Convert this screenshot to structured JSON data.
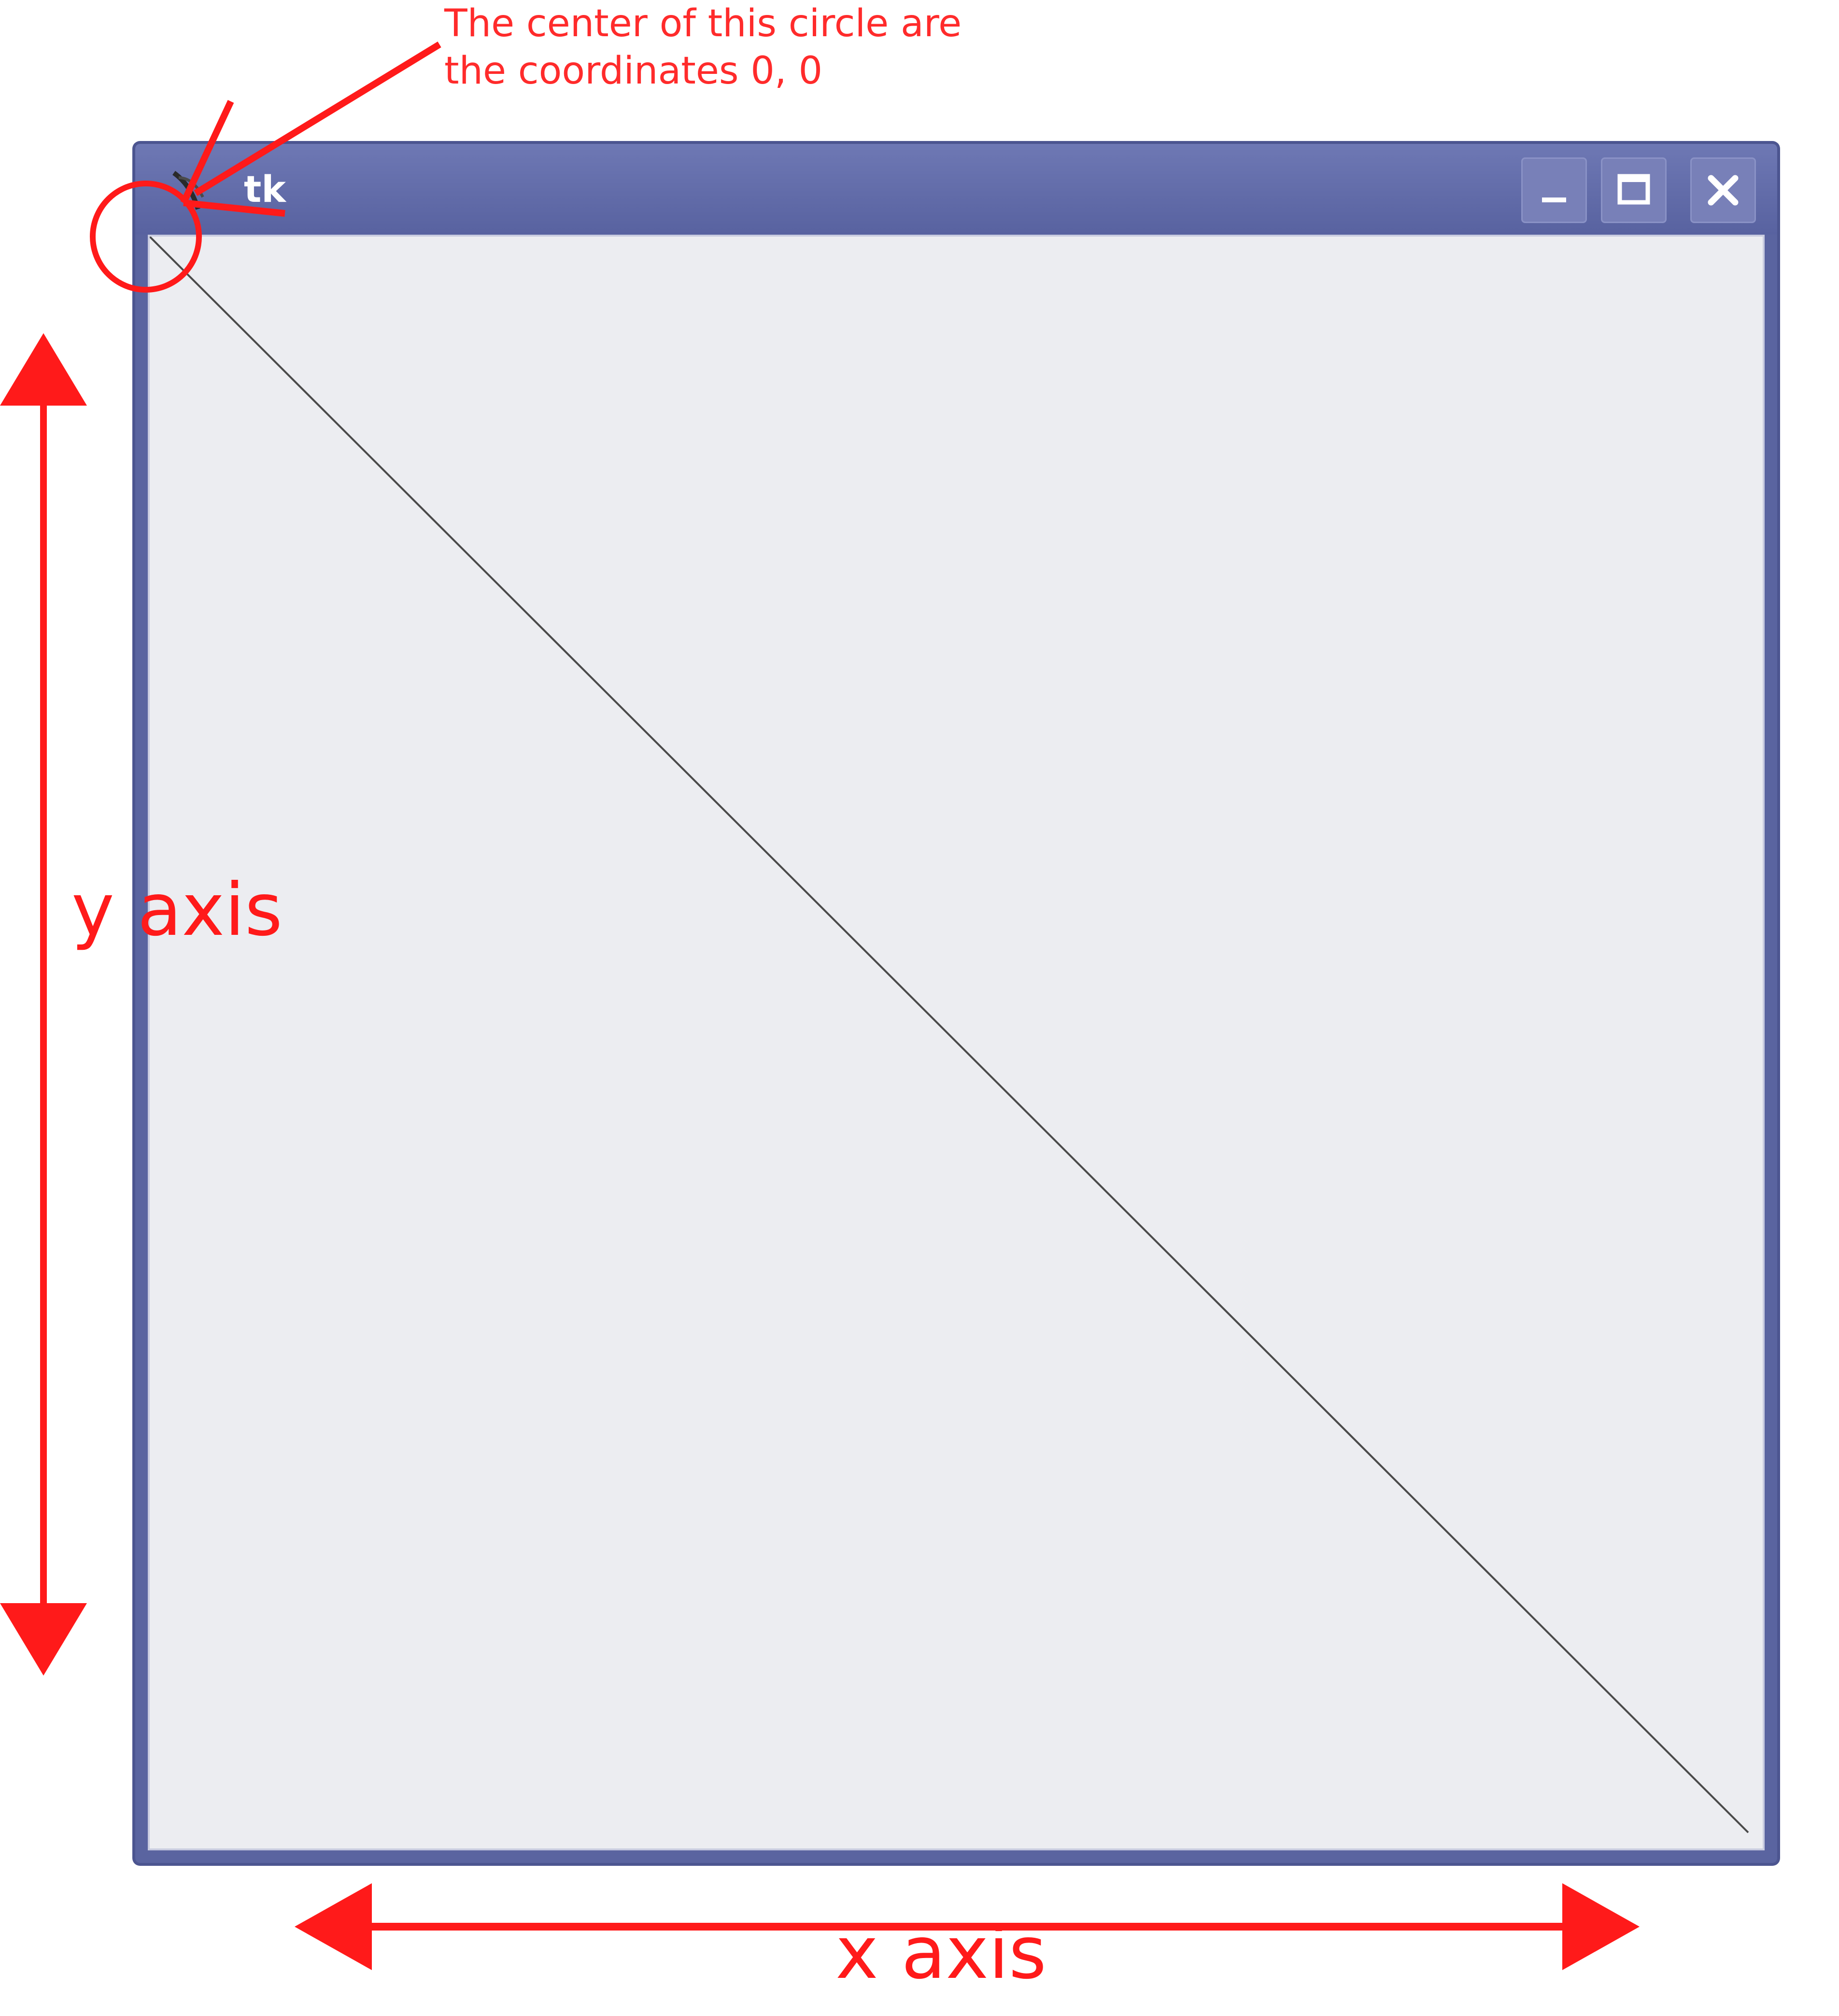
{
  "window": {
    "title": "tk",
    "controls": {
      "minimize": "minimize-icon",
      "maximize": "maximize-icon",
      "close": "close-icon"
    },
    "colors": {
      "titlebar": "#5a64a0",
      "canvas_background": "#ecedf1",
      "line": "#4a4a4a"
    }
  },
  "annotations": {
    "note_line1": "The center of this circle are",
    "note_line2": "the coordinates 0, 0",
    "y_axis_label": "y axis",
    "x_axis_label": "x axis",
    "color": "#ff1a1a"
  }
}
